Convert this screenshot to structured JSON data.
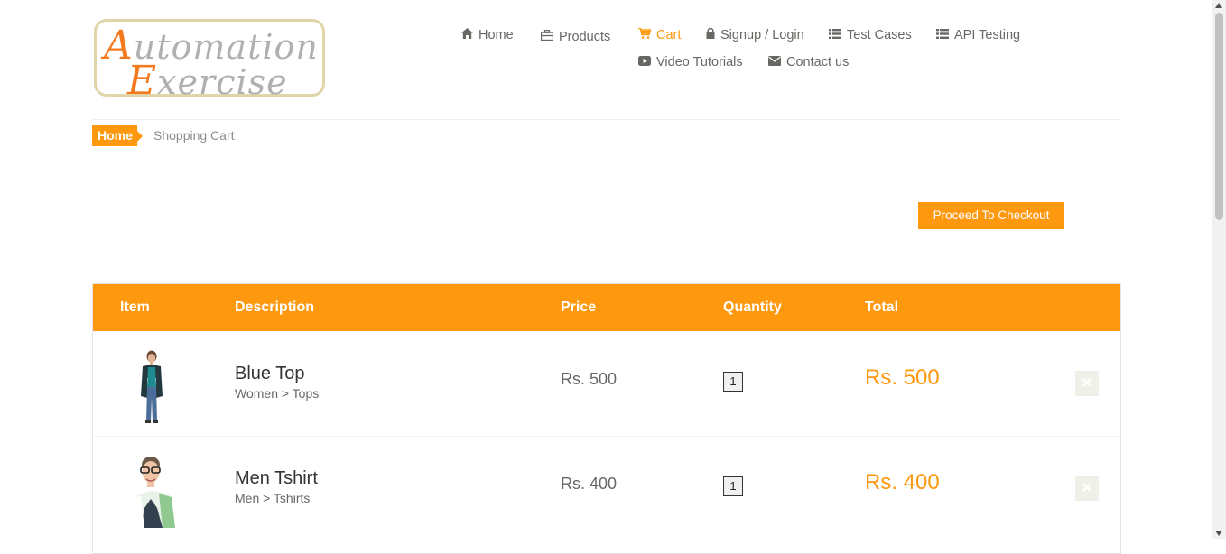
{
  "logo": {
    "line1_first": "A",
    "line1_rest": "utomation",
    "line2_first": "E",
    "line2_rest": "xercise"
  },
  "nav": {
    "home": "Home",
    "products": "Products",
    "cart": "Cart",
    "login": "Signup / Login",
    "test_cases": "Test Cases",
    "api_testing": "API Testing",
    "video_tutorials": "Video Tutorials",
    "contact": "Contact us"
  },
  "breadcrumb": {
    "home": "Home",
    "current": "Shopping Cart"
  },
  "checkout_label": "Proceed To Checkout",
  "table": {
    "headers": [
      "Item",
      "Description",
      "Price",
      "Quantity",
      "Total"
    ],
    "rows": [
      {
        "name": "Blue Top",
        "category": "Women > Tops",
        "price": "Rs. 500",
        "quantity": "1",
        "total": "Rs. 500"
      },
      {
        "name": "Men Tshirt",
        "category": "Men > Tshirts",
        "price": "Rs. 400",
        "quantity": "1",
        "total": "Rs. 400"
      }
    ]
  },
  "colors": {
    "accent": "#fe980f",
    "text": "#696763"
  }
}
